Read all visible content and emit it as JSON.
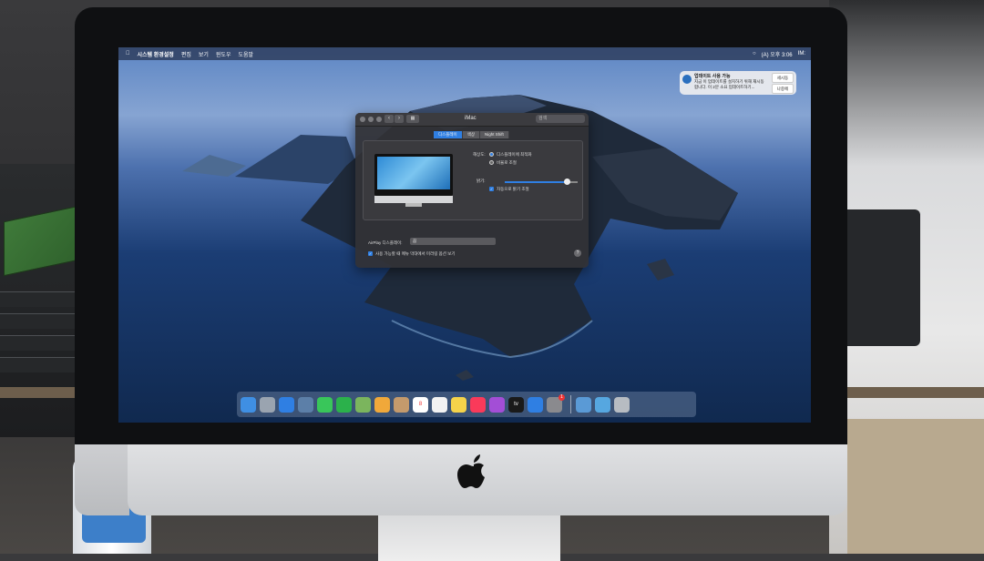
{
  "menubar": {
    "app_name": "시스템 환경설정",
    "menus": [
      "편집",
      "보기",
      "윈도우",
      "도움말"
    ],
    "status_text": "(A) 오후 3:06",
    "trailing": "IM:"
  },
  "notification": {
    "title": "업데이트 사용 가능",
    "body": "지금 이 업데이트를 설치하기 위해 재시동합니다. 이 2분 소요 업데이트하기...",
    "button_primary": "세시동",
    "button_secondary": "나중에"
  },
  "window": {
    "title": "iMac",
    "search_placeholder": "검색",
    "tabs": [
      "디스플레이",
      "색상",
      "Night Shift"
    ],
    "resolution_label": "해상도:",
    "resolution_options": [
      "디스플레이에 최적화",
      "비율로 조절"
    ],
    "brightness_label": "밝기:",
    "auto_brightness_label": "자동으로 밝기 조절",
    "airplay_label": "AirPlay 디스플레이:",
    "airplay_value": "끔",
    "mirror_checkbox_label": "사용 가능할 때 메뉴 막대에서 미러링 옵션 보기",
    "brightness_level": 0.85,
    "help": "?"
  },
  "dock": {
    "apps": [
      {
        "name": "finder",
        "color": "#3f8fe3"
      },
      {
        "name": "launchpad",
        "color": "#9aa4b0"
      },
      {
        "name": "safari",
        "color": "#2f7fe3"
      },
      {
        "name": "photos-preview",
        "color": "#5c7fa8"
      },
      {
        "name": "messages",
        "color": "#39c65a"
      },
      {
        "name": "facetime",
        "color": "#2bb14b"
      },
      {
        "name": "maps",
        "color": "#7bb55d"
      },
      {
        "name": "photos",
        "color": "#f0a83a"
      },
      {
        "name": "contacts",
        "color": "#c49a6c"
      },
      {
        "name": "calendar",
        "color": "#ffffff"
      },
      {
        "name": "reminders",
        "color": "#f2f2f2"
      },
      {
        "name": "notes",
        "color": "#f5d34a"
      },
      {
        "name": "music",
        "color": "#fa3a5a"
      },
      {
        "name": "podcasts",
        "color": "#a34ed6"
      },
      {
        "name": "tv",
        "color": "#1a1a1a"
      },
      {
        "name": "app-store",
        "color": "#2f7fe3"
      },
      {
        "name": "system-preferences",
        "color": "#8a8a8e"
      }
    ],
    "calendar_day": "8",
    "tv_label": "tv",
    "trash_side": [
      {
        "name": "downloads",
        "color": "#5a9ad6"
      },
      {
        "name": "folder",
        "color": "#56a7e0"
      },
      {
        "name": "trash",
        "color": "#b7bcc2"
      }
    ],
    "badge": "1"
  }
}
